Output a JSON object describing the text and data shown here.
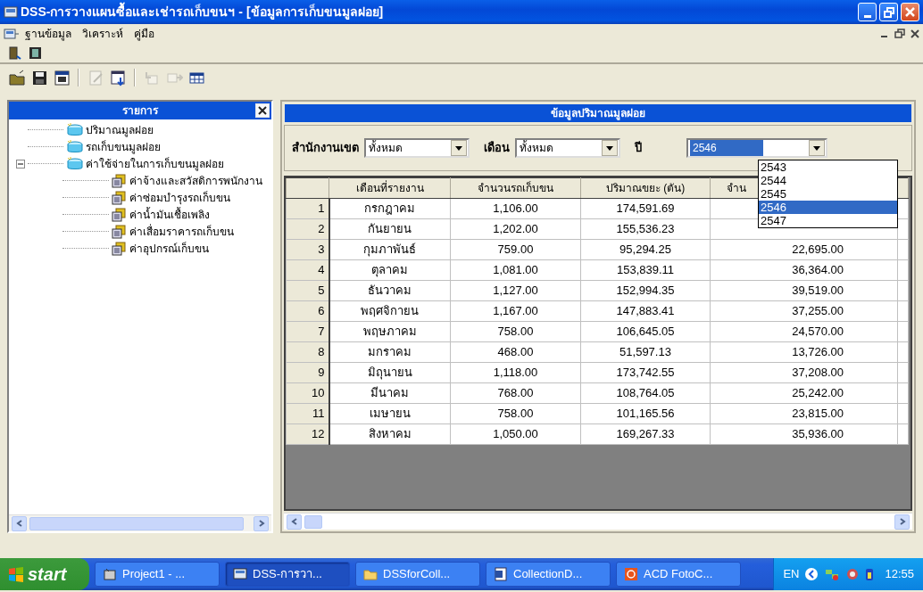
{
  "window": {
    "title": "DSS-การวางแผนซื้อและเช่ารถเก็บขนฯ - [ข้อมูลการเก็บขนมูลฝอย]"
  },
  "menu": [
    "ฐานข้อมูล",
    "วิเคราะห์",
    "คู่มือ"
  ],
  "toolbar_top": [
    {
      "kind": "button",
      "disabled": false
    },
    {
      "kind": "button",
      "disabled": false
    }
  ],
  "toolbar": [
    {
      "kind": "button",
      "disabled": false
    },
    {
      "kind": "button",
      "disabled": false
    },
    {
      "kind": "button",
      "disabled": false
    },
    {
      "kind": "separator"
    },
    {
      "kind": "button",
      "disabled": true
    },
    {
      "kind": "button",
      "disabled": false
    },
    {
      "kind": "separator"
    },
    {
      "kind": "button",
      "disabled": true
    },
    {
      "kind": "button",
      "disabled": true
    },
    {
      "kind": "button",
      "disabled": false
    }
  ],
  "sidebar": {
    "title": "รายการ",
    "items": [
      {
        "label": "ปริมาณมูลฝอย"
      },
      {
        "label": "รถเก็บขนมูลฝอย"
      },
      {
        "label": "ค่าใช้จ่ายในการเก็บขนมูลฝอย",
        "expanded": true,
        "children": [
          {
            "label": "ค่าจ้างและสวัสดิการพนักงาน"
          },
          {
            "label": "ค่าซ่อมบำรุงรถเก็บขน"
          },
          {
            "label": "ค่าน้ำมันเชื้อเพลิง"
          },
          {
            "label": "ค่าเสื่อมราคารถเก็บขน"
          },
          {
            "label": "ค่าอุปกรณ์เก็บขน"
          }
        ]
      }
    ]
  },
  "panel": {
    "title": "ข้อมูลปริมาณมูลฝอย",
    "filters": [
      {
        "label": "สำนักงานเขต",
        "value": "ทั้งหมด"
      },
      {
        "label": "เดือน",
        "value": "ทั้งหมด"
      },
      {
        "label": "ปี",
        "value": "2546",
        "open": true,
        "options": [
          {
            "label": "2543",
            "selected": false
          },
          {
            "label": "2544",
            "selected": false
          },
          {
            "label": "2545",
            "selected": false
          },
          {
            "label": "2546",
            "selected": true
          },
          {
            "label": "2547",
            "selected": false
          }
        ]
      }
    ],
    "table": {
      "columns": [
        "เดือนที่รายงาน",
        "จำนวนรถเก็บขน",
        "ปริมาณขยะ (ตัน)",
        "จำน"
      ],
      "rows": [
        {
          "index": "1",
          "cells": [
            "กรกฎาคม",
            "1,106.00",
            "174,591.69"
          ]
        },
        {
          "index": "2",
          "cells": [
            "กันยายน",
            "1,202.00",
            "155,536.23"
          ]
        },
        {
          "index": "3",
          "cells": [
            "กุมภาพันธ์",
            "759.00",
            "95,294.25",
            "22,695.00"
          ]
        },
        {
          "index": "4",
          "cells": [
            "ตุลาคม",
            "1,081.00",
            "153,839.11",
            "36,364.00"
          ]
        },
        {
          "index": "5",
          "cells": [
            "ธันวาคม",
            "1,127.00",
            "152,994.35",
            "39,519.00"
          ]
        },
        {
          "index": "6",
          "cells": [
            "พฤศจิกายน",
            "1,167.00",
            "147,883.41",
            "37,255.00"
          ]
        },
        {
          "index": "7",
          "cells": [
            "พฤษภาคม",
            "758.00",
            "106,645.05",
            "24,570.00"
          ]
        },
        {
          "index": "8",
          "cells": [
            "มกราคม",
            "468.00",
            "51,597.13",
            "13,726.00"
          ]
        },
        {
          "index": "9",
          "cells": [
            "มิถุนายน",
            "1,118.00",
            "173,742.55",
            "37,208.00"
          ]
        },
        {
          "index": "10",
          "cells": [
            "มีนาคม",
            "768.00",
            "108,764.05",
            "25,242.00"
          ]
        },
        {
          "index": "11",
          "cells": [
            "เมษายน",
            "758.00",
            "101,165.56",
            "23,815.00"
          ]
        },
        {
          "index": "12",
          "cells": [
            "สิงหาคม",
            "1,050.00",
            "169,267.33",
            "35,936.00"
          ]
        }
      ]
    }
  },
  "taskbar": {
    "start": "start",
    "tasks": [
      {
        "label": "Project1 - ...",
        "selected": false
      },
      {
        "label": "DSS-การวา...",
        "selected": true
      },
      {
        "label": "DSSforColl...",
        "selected": false
      },
      {
        "label": "CollectionD...",
        "selected": false
      },
      {
        "label": "ACD FotoC...",
        "selected": false
      }
    ],
    "language": "EN",
    "clock": "12:55"
  }
}
